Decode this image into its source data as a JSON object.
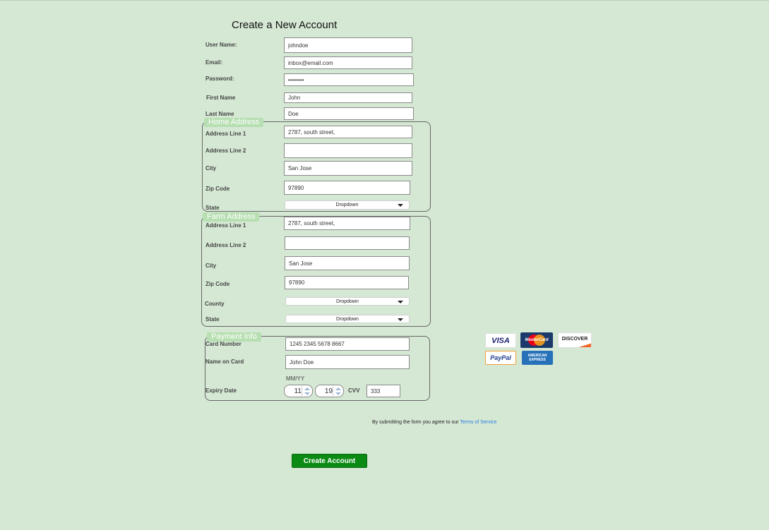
{
  "page": {
    "title": "Create a New Account"
  },
  "account": {
    "username_label": "User Name:",
    "username_value": "johndoe",
    "email_label": "Email:",
    "email_value": "inbox@email.com",
    "password_label": "Password:",
    "password_value": "••••••••",
    "firstname_label": "First Name",
    "firstname_value": "John",
    "lastname_label": "Last Name",
    "lastname_value": "Doe"
  },
  "home": {
    "legend": "Home Address",
    "addr1_label": "Address Line 1",
    "addr1_value": "2787, south street,",
    "addr2_label": "Address Line 2",
    "addr2_value": "",
    "city_label": "City",
    "city_value": "San Jose",
    "zip_label": "Zip Code",
    "zip_value": "97890",
    "state_label": "State",
    "state_value": "Dropdown"
  },
  "farm": {
    "legend": "Farm Address",
    "addr1_label": "Address Line 1",
    "addr1_value": "2787, south street,",
    "addr2_label": "Address Line 2",
    "addr2_value": "",
    "city_label": "City",
    "city_value": "San Jose",
    "zip_label": "Zip Code",
    "zip_value": "97890",
    "county_label": "County",
    "county_value": "Dropdown",
    "state_label": "State",
    "state_value": "Dropdown"
  },
  "payment": {
    "legend": "Payment Info",
    "card_label": "Card Number",
    "card_value": "1245 2345 5678 8667",
    "name_label": "Name on Card",
    "name_value": "John Doe",
    "mmyy_hint": "MM/YY",
    "expiry_label": "Expiry Date",
    "month_value": "11",
    "year_value": "19",
    "cvv_label": "CVV",
    "cvv_value": "333"
  },
  "cards": {
    "visa": "VISA",
    "mastercard": "MasterCard",
    "discover": "DISCOVER",
    "paypal": "PayPal",
    "amex": "AMERICAN EXPRESS"
  },
  "terms": {
    "text": "By submitting the form you agree to our",
    "link": "Terms of Service"
  },
  "submit": {
    "label": "Create Account"
  },
  "colors": {
    "background": "#d5e8d4",
    "legend": "#b7dfb1",
    "button": "#0b8a14",
    "link": "#2a7de1"
  }
}
